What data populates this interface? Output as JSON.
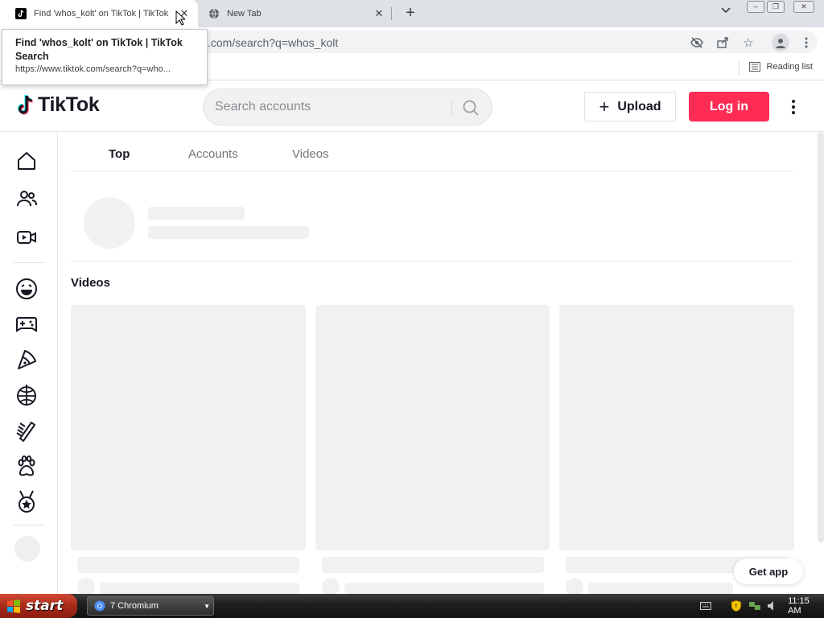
{
  "browser": {
    "tabs": [
      {
        "title": "Find 'whos_kolt' on TikTok | TikTok",
        "active": true
      },
      {
        "title": "New Tab",
        "active": false
      }
    ],
    "url": ".com/search?q=whos_kolt",
    "reading_list": "Reading list",
    "tooltip": {
      "title": "Find 'whos_kolt' on TikTok | TikTok Search",
      "url": "https://www.tiktok.com/search?q=who..."
    }
  },
  "tiktok": {
    "brand": "TikTok",
    "search_placeholder": "Search accounts",
    "upload_label": "Upload",
    "login_label": "Log in",
    "tabs": [
      {
        "label": "Top",
        "selected": true
      },
      {
        "label": "Accounts",
        "selected": false
      },
      {
        "label": "Videos",
        "selected": false
      }
    ],
    "videos_heading": "Videos",
    "get_app": "Get app",
    "accent": "#fe2c55",
    "sidebar_icons": [
      "home-icon",
      "following-icon",
      "live-icon",
      "comedy-icon",
      "gaming-icon",
      "food-icon",
      "dance-icon",
      "beauty-icon",
      "animals-icon",
      "sports-icon"
    ]
  },
  "taskbar": {
    "start_label": "start",
    "task_label": "7 Chromium",
    "clock": "11:15 AM"
  }
}
